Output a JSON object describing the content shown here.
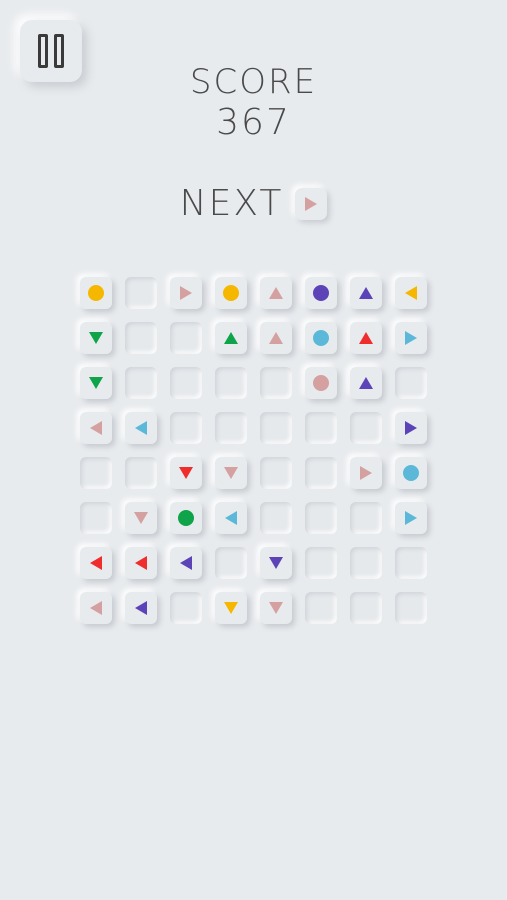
{
  "score_label": "SCORE",
  "score_value": "367",
  "next_label": "NEXT",
  "next_piece": {
    "shape": "tri-right",
    "color": "#d4a0a0"
  },
  "colors": {
    "yellow": "#f5b700",
    "purple": "#5c44b8",
    "pink": "#d4a0a0",
    "green": "#0fa34a",
    "cyan": "#5bb8d8",
    "red": "#ef2d2d"
  },
  "board": [
    [
      {
        "s": "dot",
        "c": "yellow"
      },
      null,
      {
        "s": "right",
        "c": "pink"
      },
      {
        "s": "dot",
        "c": "yellow"
      },
      {
        "s": "up",
        "c": "pink"
      },
      {
        "s": "dot",
        "c": "purple"
      },
      {
        "s": "up",
        "c": "purple"
      },
      {
        "s": "left",
        "c": "yellow"
      }
    ],
    [
      {
        "s": "down",
        "c": "green"
      },
      null,
      null,
      {
        "s": "up",
        "c": "green"
      },
      {
        "s": "up",
        "c": "pink"
      },
      {
        "s": "dot",
        "c": "cyan"
      },
      {
        "s": "up",
        "c": "red"
      },
      {
        "s": "right",
        "c": "cyan"
      }
    ],
    [
      {
        "s": "down",
        "c": "green"
      },
      null,
      null,
      null,
      null,
      {
        "s": "dot",
        "c": "pink"
      },
      {
        "s": "up",
        "c": "purple"
      },
      null
    ],
    [
      {
        "s": "left",
        "c": "pink"
      },
      {
        "s": "left",
        "c": "cyan"
      },
      null,
      null,
      null,
      null,
      null,
      {
        "s": "right",
        "c": "purple"
      }
    ],
    [
      null,
      null,
      {
        "s": "down",
        "c": "red"
      },
      {
        "s": "down",
        "c": "pink"
      },
      null,
      null,
      {
        "s": "right",
        "c": "pink"
      },
      {
        "s": "dot",
        "c": "cyan"
      }
    ],
    [
      null,
      {
        "s": "down",
        "c": "pink"
      },
      {
        "s": "dot",
        "c": "green"
      },
      {
        "s": "left",
        "c": "cyan"
      },
      null,
      null,
      null,
      {
        "s": "right",
        "c": "cyan"
      }
    ],
    [
      {
        "s": "left",
        "c": "red"
      },
      {
        "s": "left",
        "c": "red"
      },
      {
        "s": "left",
        "c": "purple"
      },
      null,
      {
        "s": "down",
        "c": "purple"
      },
      null,
      null,
      null
    ],
    [
      {
        "s": "left",
        "c": "pink"
      },
      {
        "s": "left",
        "c": "purple"
      },
      null,
      {
        "s": "down",
        "c": "yellow"
      },
      {
        "s": "down",
        "c": "pink"
      },
      null,
      null,
      null
    ]
  ]
}
